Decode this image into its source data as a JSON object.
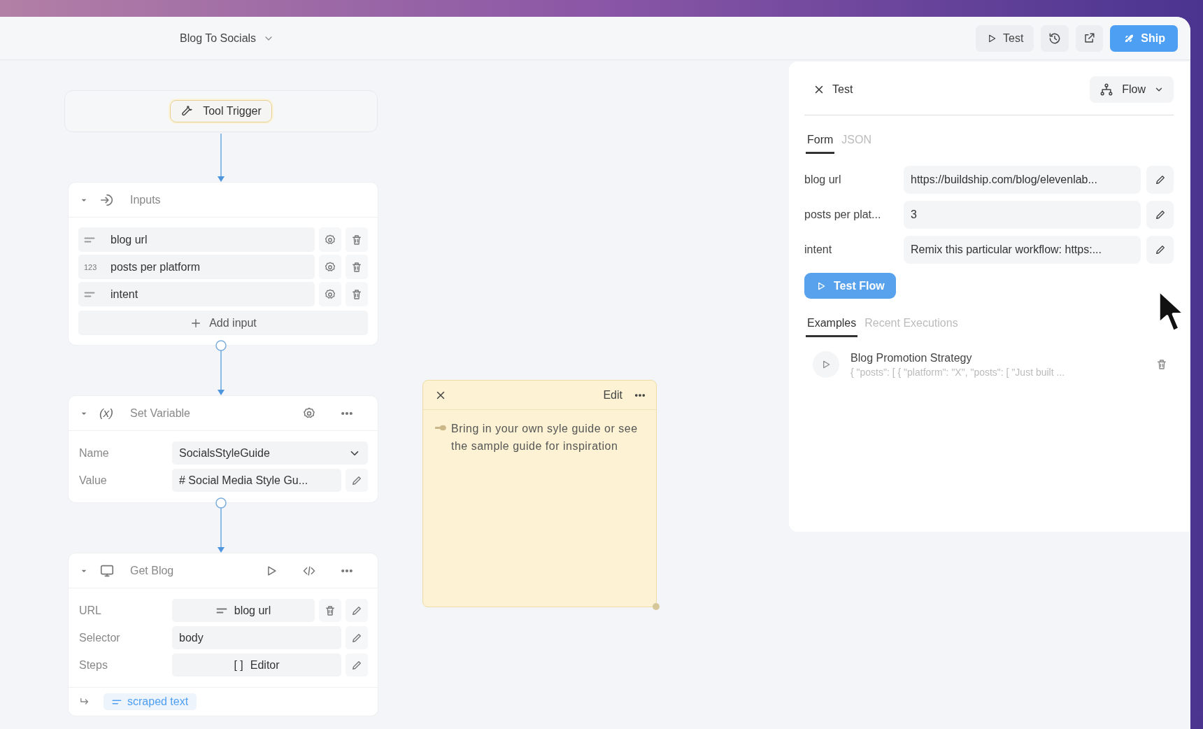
{
  "header": {
    "title": "Blog To Socials",
    "buttons": [
      {
        "kind": "test",
        "label": "Test"
      },
      {
        "kind": "history"
      },
      {
        "kind": "share"
      },
      {
        "kind": "ship",
        "label": "Ship"
      }
    ]
  },
  "trigger": {
    "label": "Tool Trigger"
  },
  "nodes": [
    {
      "kind": "inputs",
      "title": "Inputs",
      "expanded": true,
      "inputs": [
        {
          "kind": "text",
          "name": "blog url"
        },
        {
          "kind": "number",
          "badge": "123",
          "name": "posts per platform"
        },
        {
          "kind": "text",
          "name": "intent"
        }
      ],
      "add_label": "Add input"
    },
    {
      "kind": "variable",
      "icon_text": "(x)",
      "title": "Set Variable",
      "expanded": true,
      "fields": [
        {
          "kind": "select",
          "label": "Name",
          "value": "SocialsStyleGuide"
        },
        {
          "kind": "text",
          "label": "Value",
          "value": "# Social Media Style Gu..."
        }
      ]
    },
    {
      "kind": "request",
      "title": "Get Blog",
      "expanded": true,
      "fields": [
        {
          "kind": "reference",
          "label": "URL",
          "value": "blog url"
        },
        {
          "kind": "text",
          "label": "Selector",
          "value": "body"
        },
        {
          "kind": "editor",
          "label": "Steps",
          "badge": "[ ]",
          "value": "Editor"
        }
      ],
      "output": "scraped text"
    }
  ],
  "note": {
    "edit_label": "Edit",
    "text": "Bring in your own syle guide or see the sample guide for inspiration"
  },
  "panel": {
    "title": "Test",
    "mode": "Flow",
    "tabs": [
      {
        "label": "Form",
        "selected": true
      },
      {
        "label": "JSON",
        "selected": false
      }
    ],
    "fields": [
      {
        "label": "blog url",
        "value": "https://buildship.com/blog/elevenlab..."
      },
      {
        "label": "posts per plat...",
        "value": "3"
      },
      {
        "label": "intent",
        "value": "Remix this particular workflow: https:..."
      }
    ],
    "run_label": "Test Flow",
    "example_tabs": [
      {
        "label": "Examples",
        "selected": true
      },
      {
        "label": "Recent Executions",
        "selected": false
      }
    ],
    "examples": [
      {
        "title": "Blog Promotion Strategy",
        "preview": "{ \"posts\": [ { \"platform\": \"X\", \"posts\": [ \"Just built ..."
      }
    ]
  }
}
